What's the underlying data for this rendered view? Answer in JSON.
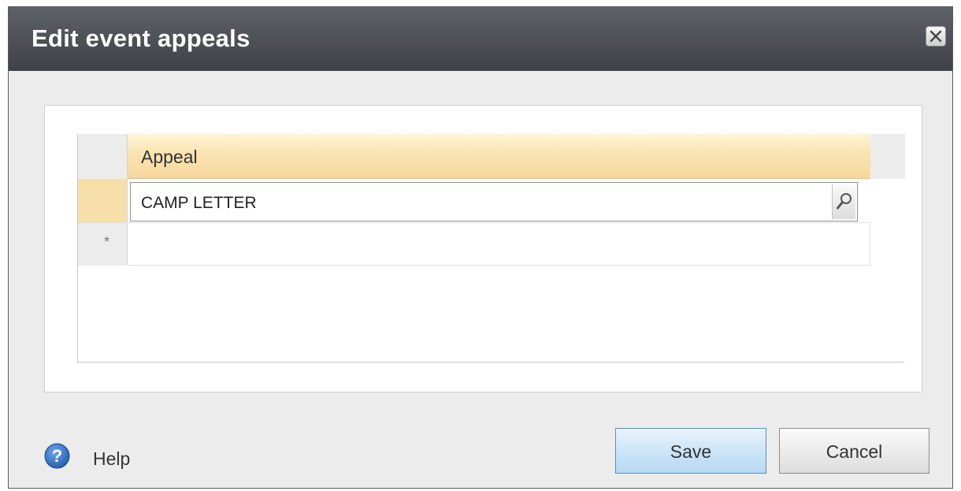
{
  "dialog": {
    "title": "Edit event appeals",
    "close_icon": "close-icon"
  },
  "grid": {
    "columns": [
      "Appeal"
    ],
    "rows": [
      {
        "appeal": "CAMP LETTER",
        "selected": true
      }
    ],
    "new_row_marker": "*",
    "lookup_icon": "search-icon"
  },
  "footer": {
    "help_label": "Help",
    "save_label": "Save",
    "cancel_label": "Cancel"
  },
  "colors": {
    "titlebar": "#4a4c52",
    "header_highlight": "#f6d79c",
    "save_button": "#cfe6f8",
    "help_icon": "#2e6fc2"
  }
}
